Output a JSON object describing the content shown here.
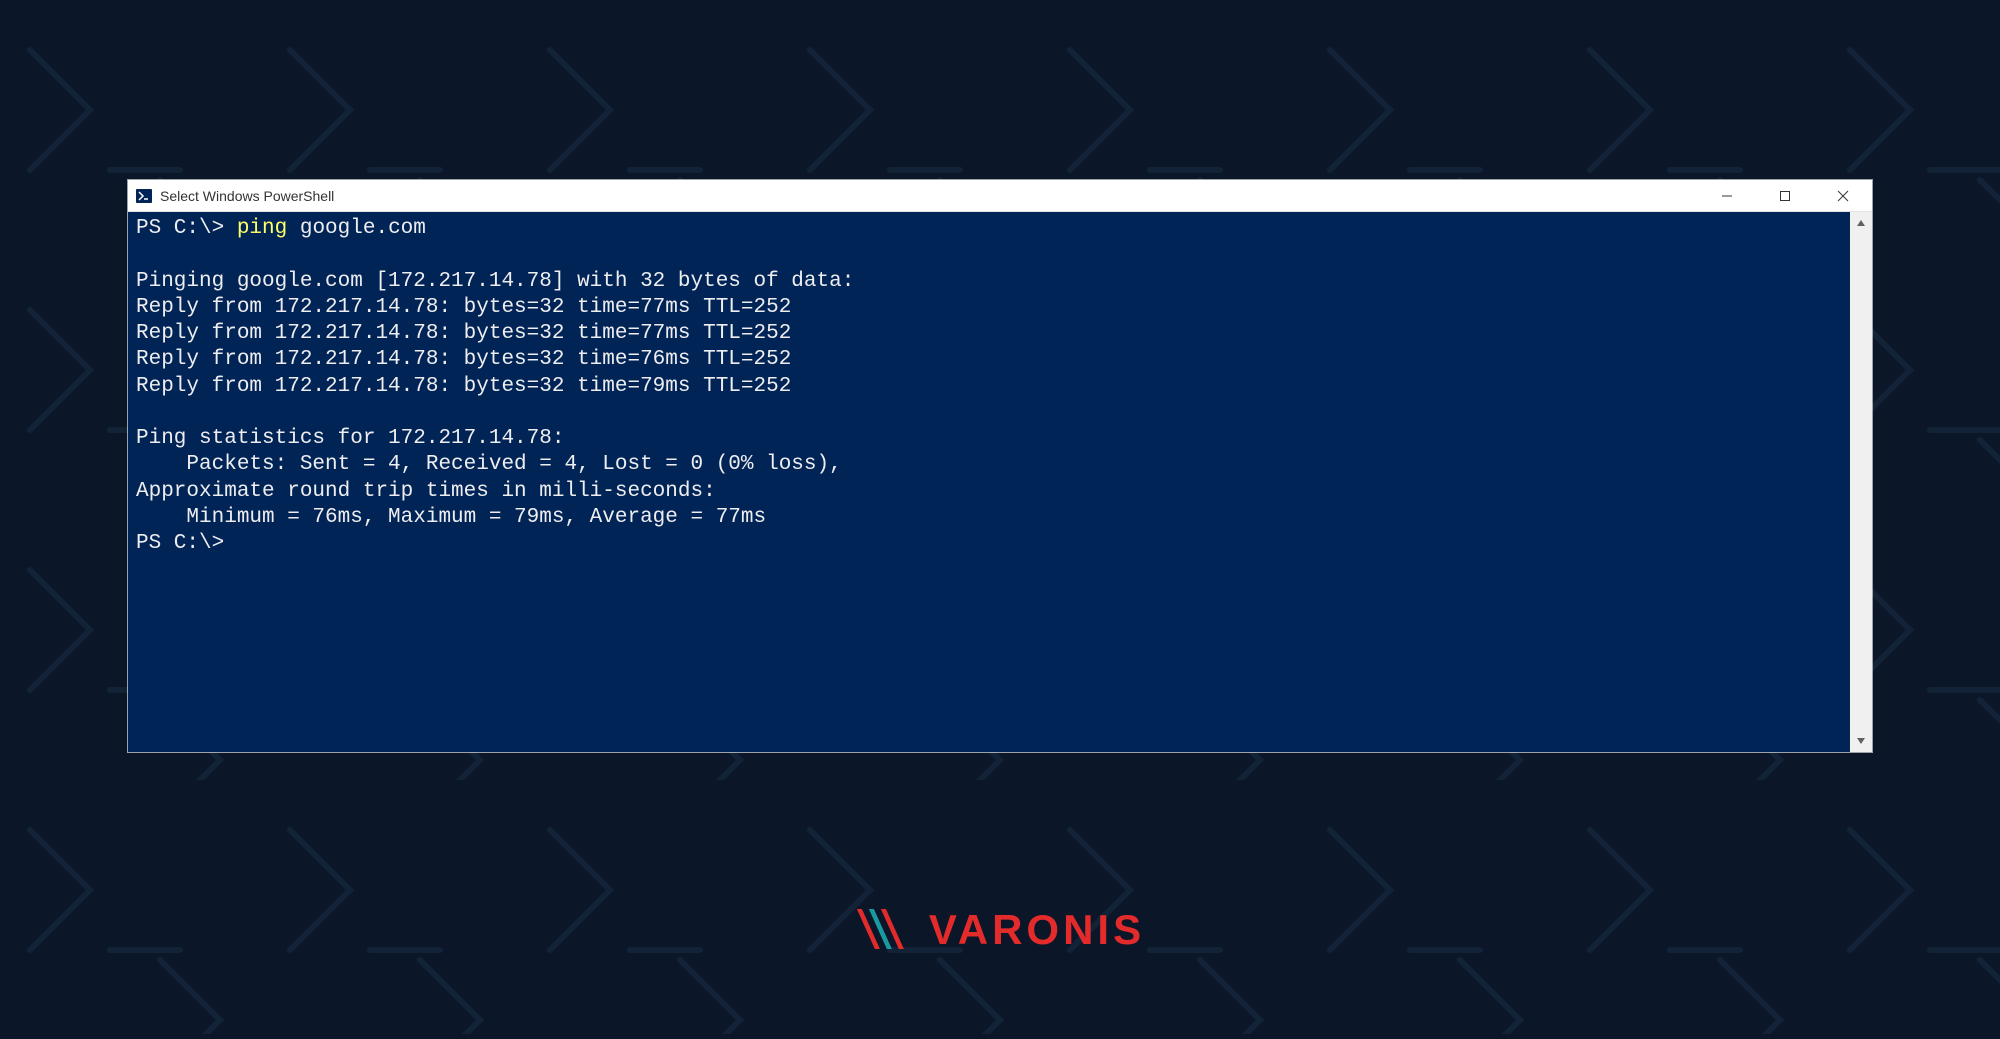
{
  "window": {
    "title": "Select Windows PowerShell"
  },
  "terminal": {
    "prompt1_prefix": "PS C:\\> ",
    "command": "ping",
    "command_arg": " google.com",
    "blank1": "",
    "pinging_line": "Pinging google.com [172.217.14.78] with 32 bytes of data:",
    "replies": [
      "Reply from 172.217.14.78: bytes=32 time=77ms TTL=252",
      "Reply from 172.217.14.78: bytes=32 time=77ms TTL=252",
      "Reply from 172.217.14.78: bytes=32 time=76ms TTL=252",
      "Reply from 172.217.14.78: bytes=32 time=79ms TTL=252"
    ],
    "blank2": "",
    "stats_header": "Ping statistics for 172.217.14.78:",
    "packets_line": "    Packets: Sent = 4, Received = 4, Lost = 0 (0% loss),",
    "rtt_header": "Approximate round trip times in milli-seconds:",
    "rtt_line": "    Minimum = 76ms, Maximum = 79ms, Average = 77ms",
    "prompt2": "PS C:\\>"
  },
  "logo": {
    "text": "VARONIS"
  },
  "icons": {
    "powershell": "powershell-icon",
    "minimize": "minimize-icon",
    "maximize": "maximize-icon",
    "close": "close-icon",
    "scroll_up": "scroll-up-icon",
    "scroll_down": "scroll-down-icon"
  }
}
